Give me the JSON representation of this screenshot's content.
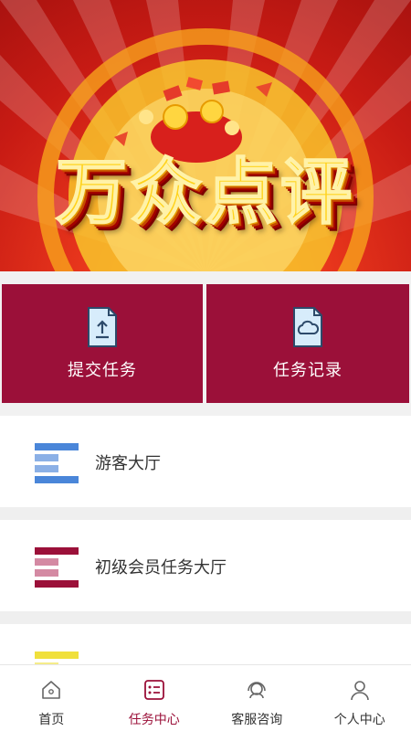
{
  "banner": {
    "title": "万众点评"
  },
  "actions": [
    {
      "label": "提交任务",
      "icon": "upload-document-icon"
    },
    {
      "label": "任务记录",
      "icon": "cloud-document-icon"
    }
  ],
  "halls": [
    {
      "label": "游客大厅",
      "icon": "list-lines-icon",
      "color": "#4a86d9"
    },
    {
      "label": "初级会员任务大厅",
      "icon": "list-lines-icon",
      "color": "#9b1039"
    },
    {
      "label": "",
      "icon": "list-lines-icon",
      "color": "#f0e03c"
    }
  ],
  "nav": [
    {
      "label": "首页",
      "icon": "home-icon",
      "active": false
    },
    {
      "label": "任务中心",
      "icon": "task-list-icon",
      "active": true
    },
    {
      "label": "客服咨询",
      "icon": "headset-icon",
      "active": false
    },
    {
      "label": "个人中心",
      "icon": "user-icon",
      "active": false
    }
  ],
  "colors": {
    "accent": "#9b1039",
    "banner_text": "#ffd21a",
    "banner_bg": "#c81b14"
  }
}
